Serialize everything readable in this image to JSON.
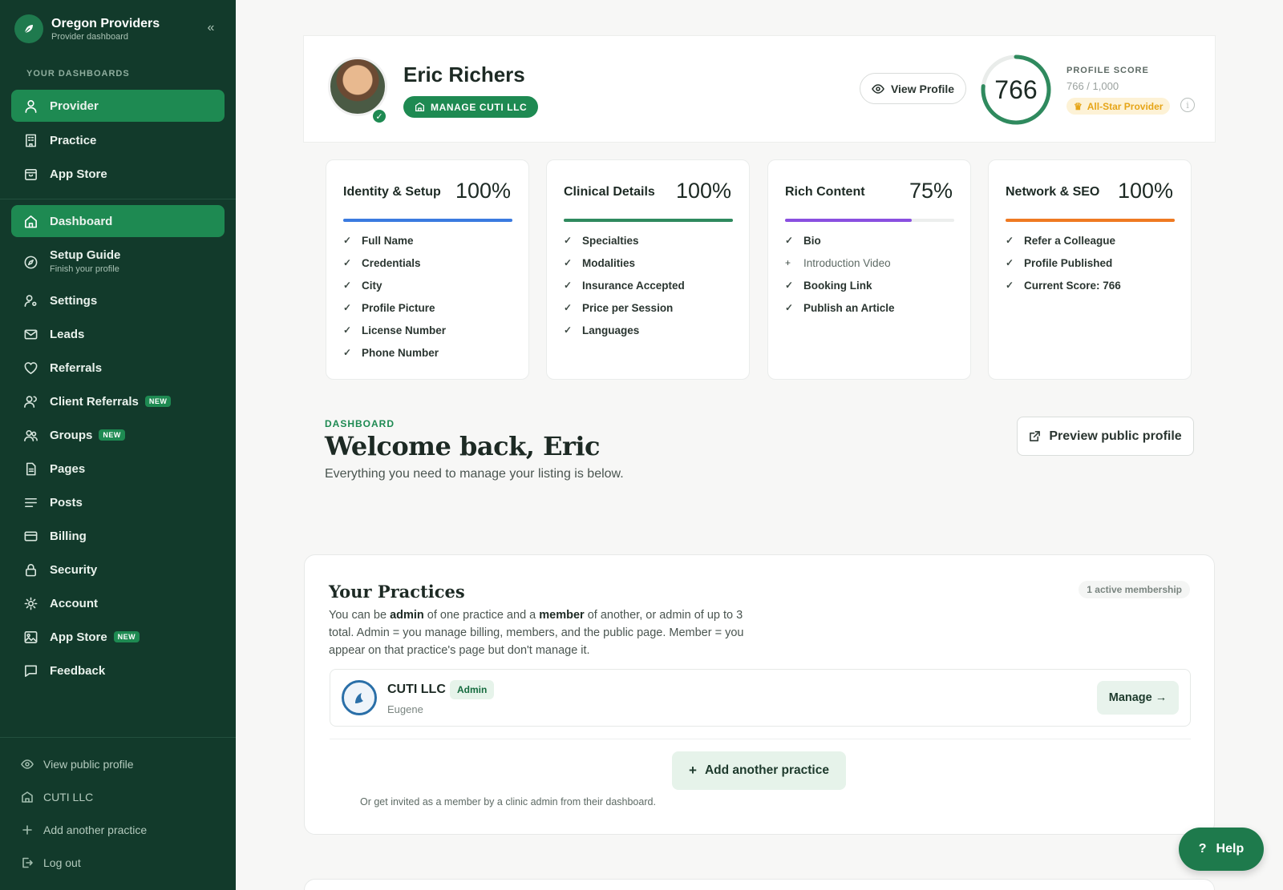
{
  "colors": {
    "sidebar_bg": "#123a2b",
    "accent": "#1e8a52",
    "identity_bar": "#3b7be0",
    "clinical_bar": "#2f8a5e",
    "rich_bar": "#8a4fe0",
    "network_bar": "#ef7a22",
    "allstar": "#e6a518"
  },
  "sidebar": {
    "brand_title": "Oregon Providers",
    "brand_subtitle": "Provider dashboard",
    "collapse_icon": "double-chevron-left-icon",
    "section_label": "YOUR DASHBOARDS",
    "top_items": [
      {
        "label": "Provider",
        "icon": "user-icon",
        "active": true
      },
      {
        "label": "Practice",
        "icon": "building-icon",
        "active": false
      },
      {
        "label": "App Store",
        "icon": "store-icon",
        "active": false
      }
    ],
    "main_items": [
      {
        "label": "Dashboard",
        "icon": "home-icon",
        "active": true
      },
      {
        "label": "Setup Guide",
        "sublabel": "Finish your profile",
        "icon": "compass-icon"
      },
      {
        "label": "Settings",
        "icon": "user-gear-icon"
      },
      {
        "label": "Leads",
        "icon": "mail-icon"
      },
      {
        "label": "Referrals",
        "icon": "heart-icon"
      },
      {
        "label": "Client Referrals",
        "badge": "NEW",
        "icon": "users-icon"
      },
      {
        "label": "Groups",
        "badge": "NEW",
        "icon": "group-icon"
      },
      {
        "label": "Pages",
        "icon": "file-icon"
      },
      {
        "label": "Posts",
        "icon": "lines-icon"
      },
      {
        "label": "Billing",
        "icon": "card-icon"
      },
      {
        "label": "Security",
        "icon": "lock-icon"
      },
      {
        "label": "Account",
        "icon": "gear-icon"
      },
      {
        "label": "App Store",
        "badge": "NEW",
        "icon": "image-icon"
      },
      {
        "label": "Feedback",
        "icon": "chat-icon"
      }
    ],
    "footer_items": [
      {
        "label": "View public profile",
        "icon": "eye-icon"
      },
      {
        "label": "CUTI LLC",
        "icon": "building-icon"
      },
      {
        "label": "Add another practice",
        "icon": "plus-icon"
      },
      {
        "label": "Log out",
        "icon": "logout-icon"
      }
    ]
  },
  "profile": {
    "name": "Eric Richers",
    "manage_label": "MANAGE CUTI LLC",
    "view_profile_label": "View Profile",
    "score": "766",
    "score_value": 766,
    "score_max": 1000,
    "score_label": "PROFILE SCORE",
    "score_of": "766 / 1,000",
    "tier_label": "All-Star Provider",
    "info_glyph": "i"
  },
  "stats": [
    {
      "title": "Identity & Setup",
      "pct": "100%",
      "fill": 1.0,
      "color": "#3b7be0",
      "items": [
        {
          "t": "Full Name",
          "done": true
        },
        {
          "t": "Credentials",
          "done": true
        },
        {
          "t": "City",
          "done": true
        },
        {
          "t": "Profile Picture",
          "done": true
        },
        {
          "t": "License Number",
          "done": true
        },
        {
          "t": "Phone Number",
          "done": true
        }
      ]
    },
    {
      "title": "Clinical Details",
      "pct": "100%",
      "fill": 1.0,
      "color": "#2f8a5e",
      "items": [
        {
          "t": "Specialties",
          "done": true
        },
        {
          "t": "Modalities",
          "done": true
        },
        {
          "t": "Insurance Accepted",
          "done": true
        },
        {
          "t": "Price per Session",
          "done": true
        },
        {
          "t": "Languages",
          "done": true
        }
      ]
    },
    {
      "title": "Rich Content",
      "pct": "75%",
      "fill": 0.75,
      "color": "#8a4fe0",
      "items": [
        {
          "t": "Bio",
          "done": true
        },
        {
          "t": "Introduction Video",
          "done": false
        },
        {
          "t": "Booking Link",
          "done": true
        },
        {
          "t": "Publish an Article",
          "done": true
        }
      ]
    },
    {
      "title": "Network & SEO",
      "pct": "100%",
      "fill": 1.0,
      "color": "#ef7a22",
      "items": [
        {
          "t": "Refer a Colleague",
          "done": true
        },
        {
          "t": "Profile Published",
          "done": true
        },
        {
          "t": "Current Score: 766",
          "done": true
        }
      ]
    }
  ],
  "dashboard": {
    "kicker": "DASHBOARD",
    "title": "Welcome back, Eric",
    "subtitle": "Everything you need to manage your listing is below.",
    "preview_label": "Preview public profile"
  },
  "practices": {
    "title": "Your Practices",
    "membership": "1 active membership",
    "desc_parts": [
      "You can be ",
      "admin",
      " of one practice and a ",
      "member",
      " of another, or admin of up to 3 total. Admin = you manage billing, members, and the public page. Member = you appear on that practice's page but don't manage it."
    ],
    "row": {
      "name": "CUTI LLC",
      "role": "Admin",
      "city": "Eugene",
      "manage_label": "Manage →"
    },
    "add_label": "Add another practice",
    "note": "Or get invited as a member by a clinic admin from their dashboard."
  },
  "help_label": "Help",
  "help_glyph": "?"
}
